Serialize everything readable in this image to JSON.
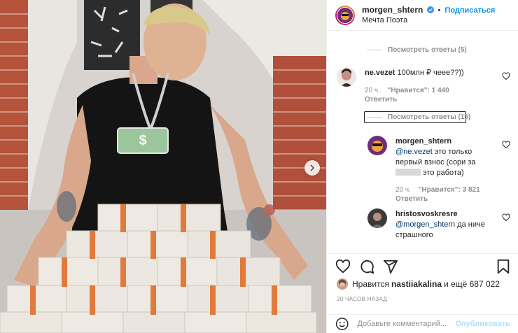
{
  "header": {
    "username": "morgen_shtern",
    "separator": "•",
    "follow_label": "Подписаться",
    "location": "Мечта Поэта"
  },
  "comments": {
    "view_replies_1": "Посмотреть ответы (5)",
    "comment_1": {
      "username": "ne.vezet",
      "text": "100млн ₽ чеее??))",
      "time": "20 ч.",
      "likes": "\"Нравится\": 1 440",
      "reply": "Ответить"
    },
    "view_replies_2": "Посмотреть ответы (16)",
    "reply_1": {
      "username": "morgen_shtern",
      "mention": "@ne.vezet",
      "text_a": " это только первый взнос (сори за ",
      "text_b": " это работа)",
      "time": "20 ч.",
      "likes": "\"Нравится\": 3 821",
      "reply": "Ответить"
    },
    "reply_2": {
      "username": "hristosvoskresre",
      "mention": "@morgen_shtern",
      "text": " да ниче страшного"
    }
  },
  "likes": {
    "prefix": "Нравится",
    "user": "nastiiakalina",
    "suffix": "и ещё 687 022"
  },
  "timestamp": "20 ЧАСОВ НАЗАД",
  "add_comment": {
    "placeholder": "Добавьте комментарий...",
    "publish_label": "Опубликовать"
  },
  "colors": {
    "link_blue": "#0095f6",
    "mention_blue": "#00376b",
    "muted": "#8e8e8e",
    "publish_disabled": "#b2dffc"
  },
  "icons": [
    "next-arrow-icon",
    "verified-badge-icon",
    "heart-icon",
    "comment-icon",
    "share-icon",
    "bookmark-icon",
    "emoji-icon"
  ]
}
